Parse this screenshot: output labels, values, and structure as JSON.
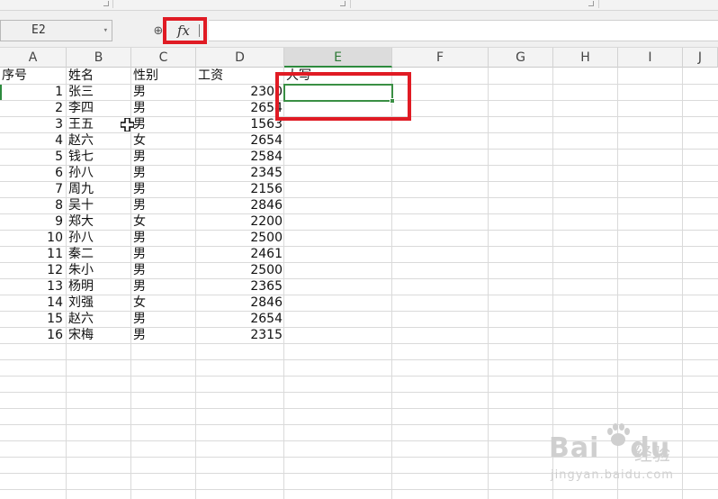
{
  "formula_bar": {
    "name_box_value": "E2",
    "fx_label": "fx",
    "formula_value": ""
  },
  "columns": [
    "A",
    "B",
    "C",
    "D",
    "E",
    "F",
    "G",
    "H",
    "I",
    "J"
  ],
  "active_column": "E",
  "active_cell": "E2",
  "headers": {
    "A": "序号",
    "B": "姓名",
    "C": "性别",
    "D": "工资",
    "E": "大写"
  },
  "rows": [
    {
      "seq": "1",
      "name": "张三",
      "gender": "男",
      "salary": "2300"
    },
    {
      "seq": "2",
      "name": "李四",
      "gender": "男",
      "salary": "2654"
    },
    {
      "seq": "3",
      "name": "王五",
      "gender": "男",
      "salary": "1563"
    },
    {
      "seq": "4",
      "name": "赵六",
      "gender": "女",
      "salary": "2654"
    },
    {
      "seq": "5",
      "name": "钱七",
      "gender": "男",
      "salary": "2584"
    },
    {
      "seq": "6",
      "name": "孙八",
      "gender": "男",
      "salary": "2345"
    },
    {
      "seq": "7",
      "name": "周九",
      "gender": "男",
      "salary": "2156"
    },
    {
      "seq": "8",
      "name": "吴十",
      "gender": "男",
      "salary": "2846"
    },
    {
      "seq": "9",
      "name": "郑大",
      "gender": "女",
      "salary": "2200"
    },
    {
      "seq": "10",
      "name": "孙八",
      "gender": "男",
      "salary": "2500"
    },
    {
      "seq": "11",
      "name": "秦二",
      "gender": "男",
      "salary": "2461"
    },
    {
      "seq": "12",
      "name": "朱小",
      "gender": "男",
      "salary": "2500"
    },
    {
      "seq": "13",
      "name": "杨明",
      "gender": "男",
      "salary": "2365"
    },
    {
      "seq": "14",
      "name": "刘强",
      "gender": "女",
      "salary": "2846"
    },
    {
      "seq": "15",
      "name": "赵六",
      "gender": "男",
      "salary": "2654"
    },
    {
      "seq": "16",
      "name": "宋梅",
      "gender": "男",
      "salary": "2315"
    }
  ],
  "watermark": {
    "brand": "Bai",
    "brand2": "du",
    "cn": "经验",
    "url": "jingyan.baidu.com"
  },
  "colors": {
    "accent_green": "#3a8f44",
    "annotation_red": "#e01b24"
  }
}
